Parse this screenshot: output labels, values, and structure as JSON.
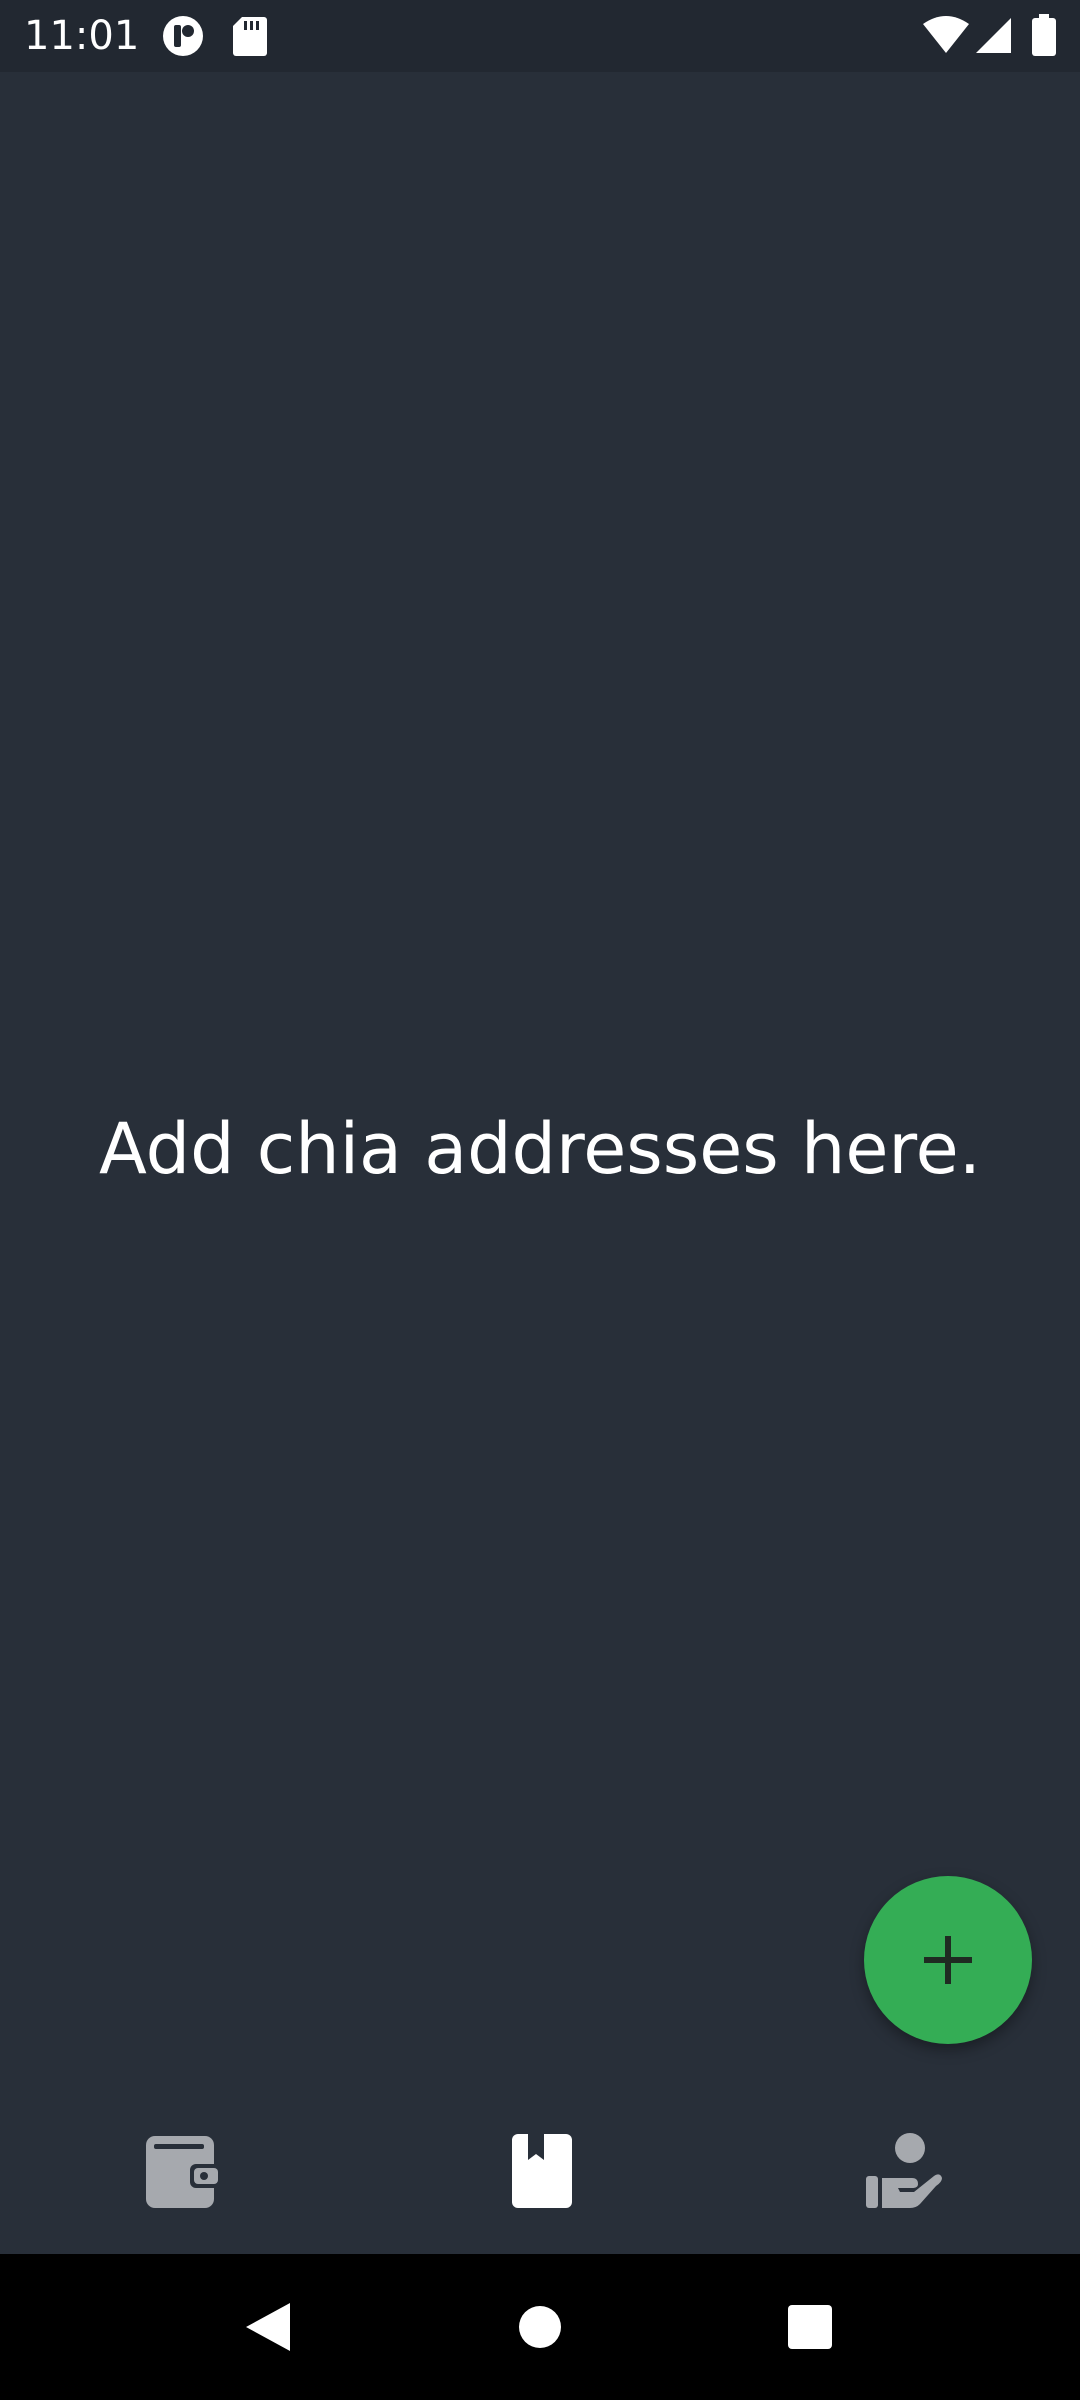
{
  "status_bar": {
    "time": "11:01",
    "left_icons": [
      "app-notification-icon",
      "sd-card-icon"
    ],
    "right_icons": [
      "wifi-icon",
      "cell-signal-icon",
      "battery-icon"
    ]
  },
  "main": {
    "empty_message": "Add chia addresses here."
  },
  "fab": {
    "icon": "plus-icon",
    "color": "#34ad55"
  },
  "bottom_nav": {
    "items": [
      {
        "icon": "wallet-icon",
        "active": false
      },
      {
        "icon": "bookmark-icon",
        "active": true
      },
      {
        "icon": "hand-person-icon",
        "active": false
      }
    ],
    "active_color": "#ffffff",
    "inactive_color": "#a6a9ae"
  },
  "system_nav": {
    "buttons": [
      "back-icon",
      "home-icon",
      "recents-icon"
    ]
  },
  "colors": {
    "background": "#282f39",
    "status_bar": "#222831",
    "text": "#ffffff"
  }
}
